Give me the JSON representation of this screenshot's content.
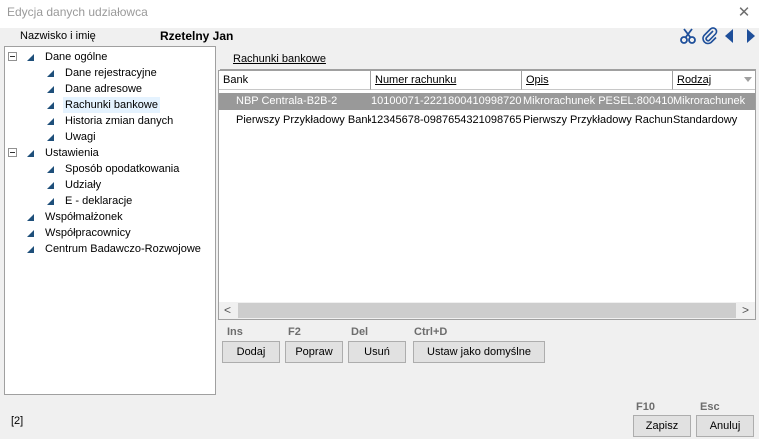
{
  "window": {
    "title": "Edycja danych udziałowca",
    "close_glyph": "✕"
  },
  "header": {
    "name_label": "Nazwisko i imię",
    "name_value": "Rzetelny Jan",
    "toolbar_icons": [
      "scissors-icon",
      "paperclip-icon",
      "arrow-left-icon",
      "arrow-right-icon"
    ],
    "icon_color": "#1e4f9a"
  },
  "tree": {
    "nodes": [
      {
        "label": "Dane ogólne",
        "level": 0,
        "expander": true
      },
      {
        "label": "Dane rejestracyjne",
        "level": 1
      },
      {
        "label": "Dane adresowe",
        "level": 1
      },
      {
        "label": "Rachunki bankowe",
        "level": 1,
        "selected": true
      },
      {
        "label": "Historia zmian danych",
        "level": 1
      },
      {
        "label": "Uwagi",
        "level": 1
      },
      {
        "label": "Ustawienia",
        "level": 0,
        "expander": true
      },
      {
        "label": "Sposób opodatkowania",
        "level": 1
      },
      {
        "label": "Udziały",
        "level": 1
      },
      {
        "label": "E - deklaracje",
        "level": 1
      },
      {
        "label": "Współmałżonek",
        "level": 0
      },
      {
        "label": "Współpracownicy",
        "level": 0
      },
      {
        "label": "Centrum Badawczo-Rozwojowe",
        "level": 0
      }
    ]
  },
  "section": {
    "tab_label": "Rachunki bankowe"
  },
  "table": {
    "columns": [
      "Bank",
      "Numer rachunku",
      "Opis",
      "Rodzaj"
    ],
    "rows": [
      [
        "NBP Centrala-B2B-2",
        "10100071-2221800410998720",
        "Mikrorachunek PESEL:800410",
        "Mikrorachunek"
      ],
      [
        "Pierwszy Przykładowy Bank",
        "12345678-0987654321098765",
        "Pierwszy Przykładowy Rachunek",
        "Standardowy"
      ]
    ],
    "selected_row": 0,
    "selected_color": "#999999",
    "scroll_left": "<",
    "scroll_right": ">"
  },
  "actions": [
    {
      "key": "Ins",
      "label": "Dodaj"
    },
    {
      "key": "F2",
      "label": "Popraw"
    },
    {
      "key": "Del",
      "label": "Usuń"
    },
    {
      "key": "Ctrl+D",
      "label": "Ustaw jako domyślne"
    }
  ],
  "footer": {
    "status": "[2]",
    "save": {
      "key": "F10",
      "label": "Zapisz"
    },
    "cancel": {
      "key": "Esc",
      "label": "Anuluj"
    }
  }
}
